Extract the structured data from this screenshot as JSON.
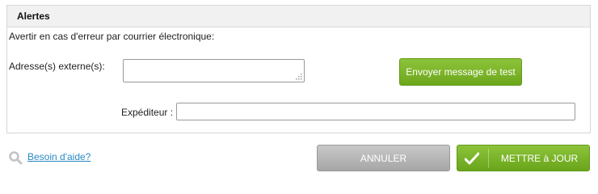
{
  "panel": {
    "title": "Alertes",
    "intro": "Avertir en cas d'erreur par courrier électronique:",
    "external_label": "Adresse(s) externe(s):",
    "external_value": "",
    "test_button_label": "Envoyer message de test",
    "sender_label": "Expéditeur :",
    "sender_value": ""
  },
  "footer": {
    "help_link": "Besoin d'aide?",
    "cancel_label": "ANNULER",
    "save_label": "METTRE à JOUR"
  },
  "colors": {
    "accent_green": "#7ab62a",
    "cancel_gray": "#b3b3b3",
    "link_blue": "#2a8ac5"
  },
  "icons": {
    "help": "magnifier-icon",
    "save": "checkmark-icon",
    "textarea_grip": "resize-grip-icon"
  }
}
